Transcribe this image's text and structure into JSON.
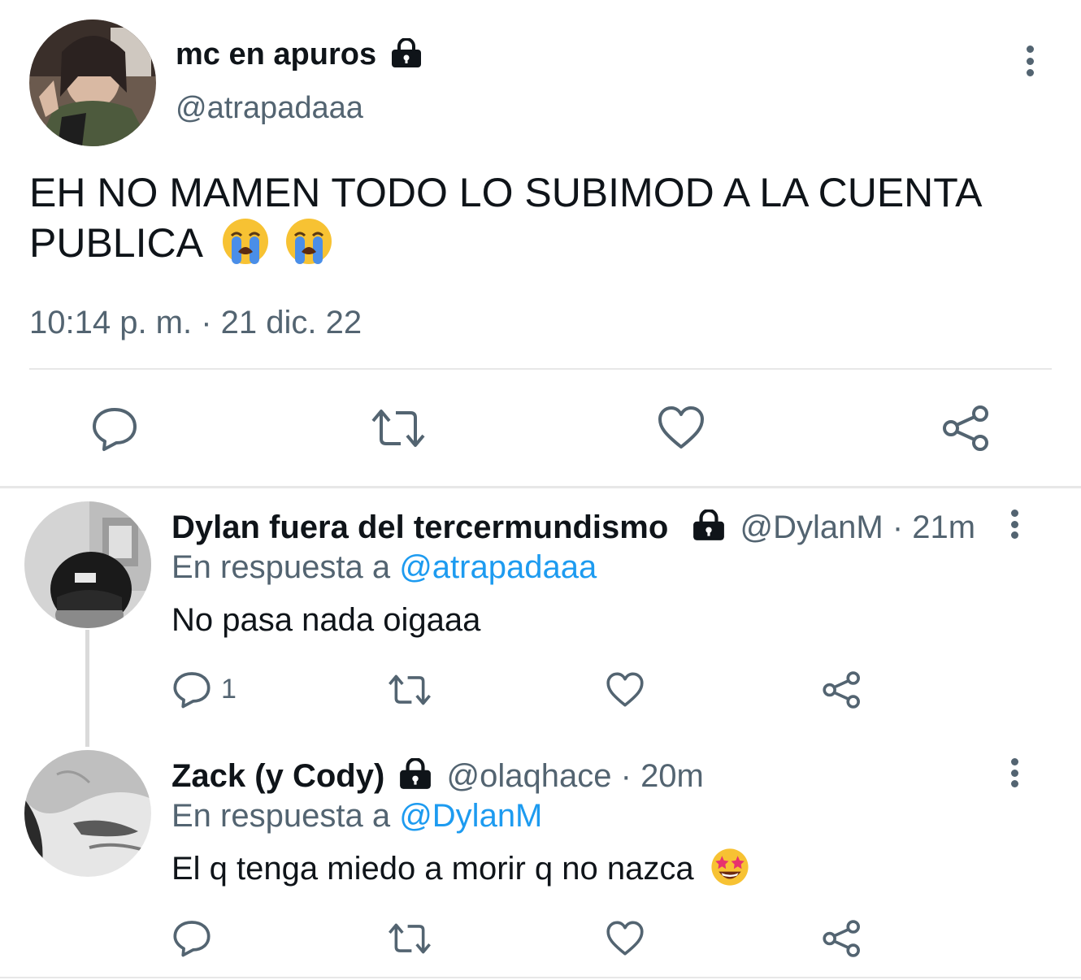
{
  "main_tweet": {
    "display_name": "mc en apuros",
    "handle": "@atrapadaaa",
    "text_line1": "EH NO MAMEN TODO LO SUBIMOD A LA CUENTA",
    "text_line2": "PUBLICA",
    "emojis": [
      "loudly-crying-face",
      "loudly-crying-face"
    ],
    "timestamp": "10:14 p. m. · 21 dic. 22",
    "actions": [
      "reply",
      "retweet",
      "like",
      "share"
    ]
  },
  "replies": [
    {
      "display_name": "Dylan fuera del tercermundismo",
      "handle_time": "@DylanM · 21m",
      "in_reply_prefix": "En respuesta a",
      "in_reply_to": "@atrapadaaa",
      "text": "No pasa nada oigaaa",
      "reply_count": "1"
    },
    {
      "display_name": "Zack (y Cody)",
      "handle_time": "@olaqhace · 20m",
      "in_reply_prefix": "En respuesta a",
      "in_reply_to": "@DylanM",
      "text": "El q tenga miedo a morir q no nazca",
      "emoji": "star-struck",
      "reply_count": ""
    }
  ],
  "colors": {
    "text": "#0f1419",
    "secondary": "#536471",
    "link": "#1d9bf0",
    "divider": "#e7e7e7"
  }
}
